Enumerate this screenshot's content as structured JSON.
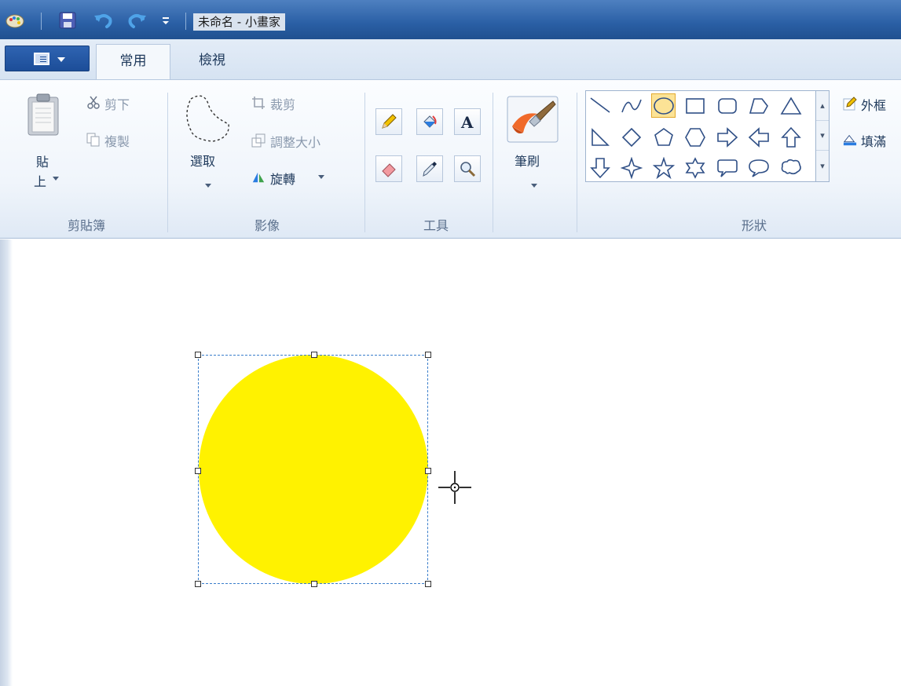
{
  "window": {
    "title": "未命名 - 小畫家"
  },
  "quick_access": {
    "icons": [
      "paint-app-icon",
      "save-icon",
      "undo-icon",
      "redo-icon",
      "customize-dropdown-icon"
    ]
  },
  "ribbon_tabs": {
    "file_menu": "file-menu",
    "home": "常用",
    "view": "檢視"
  },
  "clipboard": {
    "paste": "貼",
    "paste2": "上",
    "cut": "剪下",
    "copy": "複製",
    "group_label": "剪貼簿"
  },
  "image": {
    "select": "選取",
    "crop": "裁剪",
    "resize": "調整大小",
    "rotate": "旋轉",
    "group_label": "影像"
  },
  "tools": {
    "group_label": "工具",
    "items": [
      "pencil-icon",
      "fill-bucket-icon",
      "text-icon",
      "eraser-icon",
      "color-picker-icon",
      "magnifier-icon"
    ]
  },
  "brushes": {
    "label": "筆刷"
  },
  "shapes": {
    "group_label": "形狀",
    "outline": "外框",
    "fill": "填滿",
    "selected": "ellipse-shape",
    "items": [
      "line-shape",
      "curve-shape",
      "ellipse-shape",
      "rectangle-shape",
      "rounded-rectangle-shape",
      "polygon-shape",
      "triangle-shape",
      "right-triangle-shape",
      "diamond-shape",
      "pentagon-shape",
      "hexagon-shape",
      "right-arrow-shape",
      "left-arrow-shape",
      "up-arrow-shape",
      "down-arrow-shape",
      "four-point-star-shape",
      "five-point-star-shape",
      "six-point-star-shape",
      "rounded-callout-shape",
      "oval-callout-shape",
      "cloud-callout-shape"
    ]
  },
  "canvas": {
    "shape_fill_color": "#fff200",
    "selection_color": "#3a7ecb"
  },
  "colors": {
    "accent": "#2a5fa5",
    "ribbon_text": "#1e395b"
  }
}
